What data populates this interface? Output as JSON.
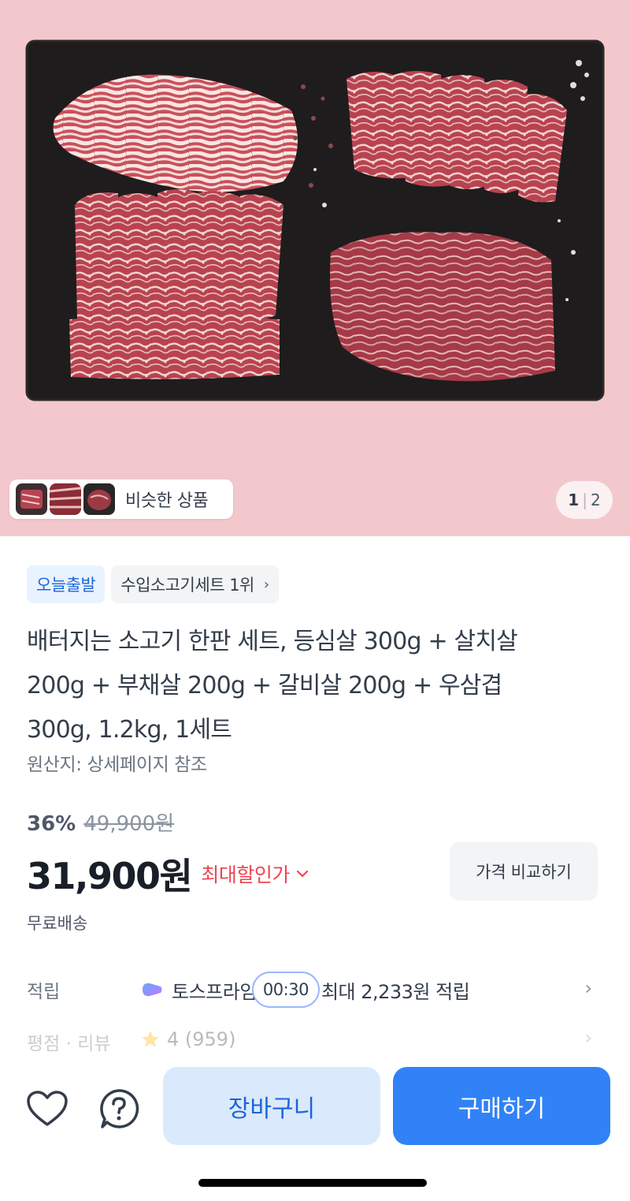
{
  "gallery": {
    "similar_label": "비슷한 상품",
    "page_current": "1",
    "page_total": "2"
  },
  "tags": {
    "shipping_tag": "오늘출발",
    "ranking_tag": "수입소고기세트 1위"
  },
  "product": {
    "title_line1": "배터지는 소고기 한판 세트, 등심살 300g + 살치살",
    "title_line2": "200g + 부채살 200g + 갈비살 200g + 우삼겹",
    "title_line3": "300g, 1.2kg, 1세트",
    "origin": "원산지: 상세페이지 참조"
  },
  "price": {
    "discount_rate": "36%",
    "original_price": "49,900원",
    "sale_price": "31,900원",
    "max_discount_label": "최대할인가",
    "compare_label": "가격 비교하기",
    "shipping": "무료배송"
  },
  "reward": {
    "label": "적립",
    "program": "토스프라임",
    "timer": "00:30",
    "text": "최대 2,233원 적립"
  },
  "review": {
    "label": "평점 · 리뷰",
    "rating": "4 (959)"
  },
  "bottom": {
    "cart_label": "장바구니",
    "buy_label": "구매하기"
  },
  "colors": {
    "accent": "#3182f6",
    "accent_light": "#dbe9fc",
    "discount_red": "#f04452",
    "hero_bg": "#f3c8cc"
  }
}
